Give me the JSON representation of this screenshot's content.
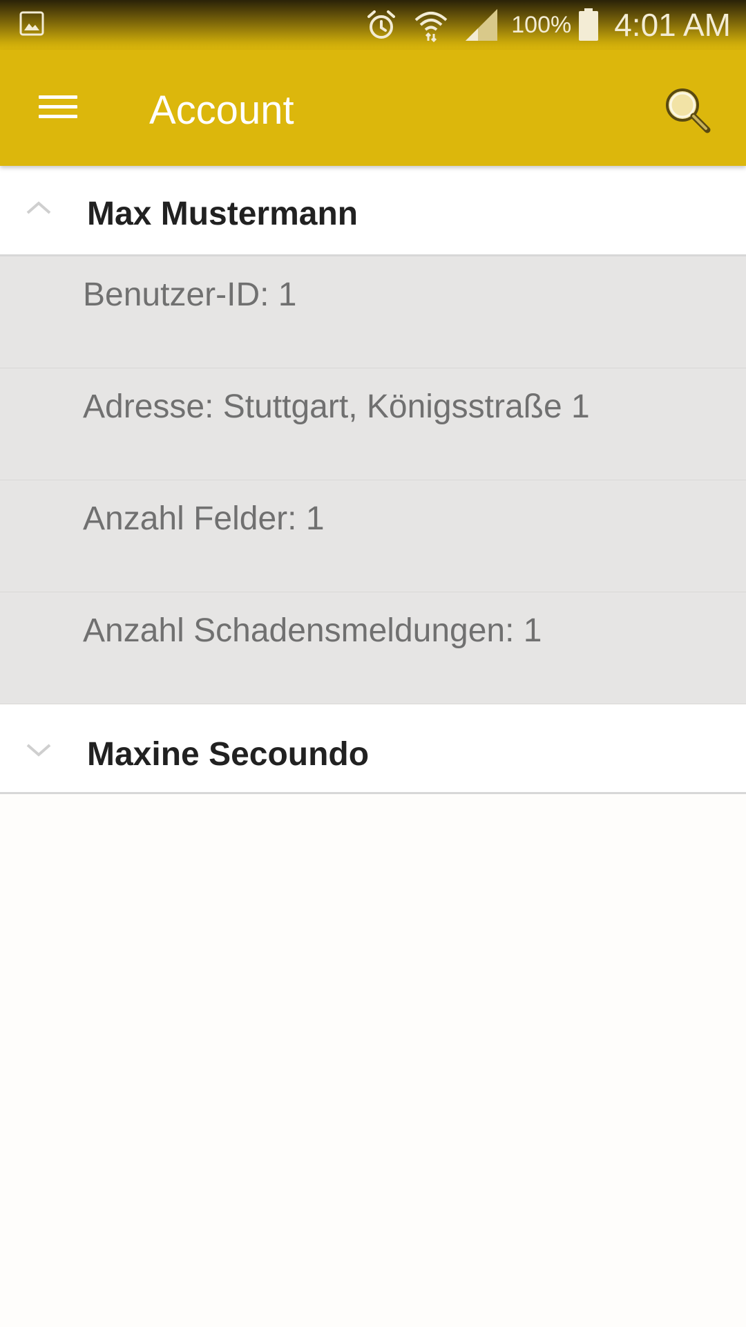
{
  "status_bar": {
    "icons": [
      "gallery-icon",
      "alarm-icon",
      "wifi-icon",
      "signal-icon",
      "battery-icon"
    ],
    "battery": "100%",
    "time": "4:01 AM"
  },
  "app_bar": {
    "title": "Account",
    "background": "#dcb70c",
    "icons": [
      "menu-icon",
      "search-icon"
    ]
  },
  "accounts": [
    {
      "name": "Max Mustermann",
      "expanded": true,
      "details": [
        "Benutzer-ID: 1",
        "Adresse: Stuttgart, Königsstraße 1",
        "Anzahl Felder: 1",
        "Anzahl Schadensmeldungen: 1"
      ]
    },
    {
      "name": "Maxine Secoundo",
      "expanded": false,
      "details": []
    }
  ]
}
